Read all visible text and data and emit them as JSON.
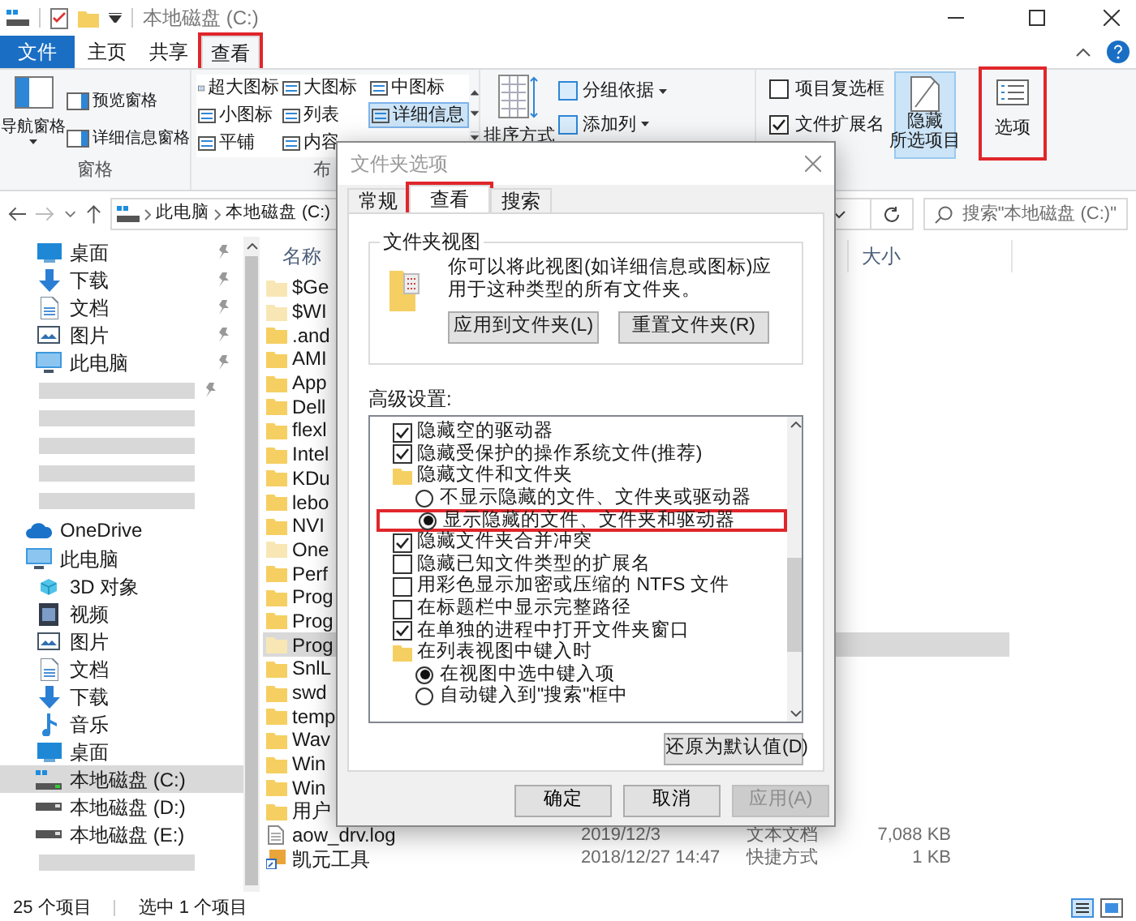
{
  "window": {
    "title": "本地磁盘 (C:)"
  },
  "ribbon": {
    "tabs": [
      {
        "label": "文件",
        "kind": "file",
        "selected": false,
        "annotated": false
      },
      {
        "label": "主页",
        "kind": "tab",
        "selected": false,
        "annotated": false
      },
      {
        "label": "共享",
        "kind": "tab",
        "selected": false,
        "annotated": false
      },
      {
        "label": "查看",
        "kind": "tab",
        "selected": true,
        "annotated": true
      }
    ],
    "pane_group": {
      "large_button": "导航窗格",
      "items": [
        "预览窗格",
        "详细信息窗格"
      ],
      "label": "窗格"
    },
    "layout_group": {
      "options": [
        {
          "label": "超大图标",
          "selected": false
        },
        {
          "label": "大图标",
          "selected": false
        },
        {
          "label": "中图标",
          "selected": false
        },
        {
          "label": "小图标",
          "selected": false
        },
        {
          "label": "列表",
          "selected": false
        },
        {
          "label": "详细信息",
          "selected": true
        },
        {
          "label": "平铺",
          "selected": false
        },
        {
          "label": "内容",
          "selected": false
        }
      ],
      "label": "布"
    },
    "view_group": {
      "sort_button": "排序方式",
      "items": [
        "分组依据",
        "添加列"
      ]
    },
    "show_group": {
      "checks": [
        {
          "label": "项目复选框",
          "checked": false
        },
        {
          "label": "文件扩展名",
          "checked": true
        }
      ],
      "hide_button": [
        "隐藏",
        "所选项目"
      ]
    },
    "options_button": {
      "label": "选项",
      "annotated": true
    }
  },
  "address": {
    "path": [
      "此电脑",
      "本地磁盘 (C:)"
    ],
    "search_placeholder": "搜索\"本地磁盘 (C:)\""
  },
  "nav": [
    {
      "label": "桌面",
      "kind": "desktop",
      "pinned": true,
      "selected": false
    },
    {
      "label": "下载",
      "kind": "download",
      "pinned": true,
      "selected": false
    },
    {
      "label": "文档",
      "kind": "document",
      "pinned": true,
      "selected": false
    },
    {
      "label": "图片",
      "kind": "picture",
      "pinned": true,
      "selected": false
    },
    {
      "label": "此电脑",
      "kind": "computer",
      "pinned": true,
      "selected": false
    },
    {
      "kind": "redacted",
      "pinned": true,
      "selected": false
    },
    {
      "kind": "redacted",
      "pinned": false,
      "selected": false
    },
    {
      "kind": "redacted",
      "pinned": false,
      "selected": false
    },
    {
      "kind": "redacted",
      "pinned": false,
      "selected": false
    },
    {
      "kind": "redacted",
      "pinned": false,
      "selected": false
    },
    {
      "label": "OneDrive",
      "kind": "cloud",
      "pinned": false,
      "selected": false,
      "top": true
    },
    {
      "label": "此电脑",
      "kind": "computer",
      "pinned": false,
      "selected": false,
      "top": true
    },
    {
      "label": "3D 对象",
      "kind": "cube",
      "pinned": false,
      "selected": false
    },
    {
      "label": "视频",
      "kind": "video",
      "pinned": false,
      "selected": false
    },
    {
      "label": "图片",
      "kind": "picture",
      "pinned": false,
      "selected": false
    },
    {
      "label": "文档",
      "kind": "document",
      "pinned": false,
      "selected": false
    },
    {
      "label": "下载",
      "kind": "download",
      "pinned": false,
      "selected": false
    },
    {
      "label": "音乐",
      "kind": "music",
      "pinned": false,
      "selected": false
    },
    {
      "label": "桌面",
      "kind": "desktop",
      "pinned": false,
      "selected": false
    },
    {
      "label": "本地磁盘 (C:)",
      "kind": "system-drive",
      "pinned": false,
      "selected": true
    },
    {
      "label": "本地磁盘 (D:)",
      "kind": "drive",
      "pinned": false,
      "selected": false
    },
    {
      "label": "本地磁盘 (E:)",
      "kind": "drive",
      "pinned": false,
      "selected": false
    },
    {
      "kind": "redacted",
      "pinned": false,
      "selected": false
    }
  ],
  "files": {
    "columns": [
      "名称",
      "大小"
    ],
    "rows": [
      {
        "name": "$Ge",
        "kind": "folder",
        "hidden": true,
        "selected": false
      },
      {
        "name": "$WI",
        "kind": "folder",
        "hidden": true,
        "selected": false
      },
      {
        "name": ".and",
        "kind": "folder",
        "hidden": false,
        "selected": false
      },
      {
        "name": "AMI",
        "kind": "folder",
        "hidden": false,
        "selected": false
      },
      {
        "name": "App",
        "kind": "folder",
        "hidden": false,
        "selected": false
      },
      {
        "name": "Dell",
        "kind": "folder",
        "hidden": false,
        "selected": false
      },
      {
        "name": "flexl",
        "kind": "folder",
        "hidden": false,
        "selected": false
      },
      {
        "name": "Intel",
        "kind": "folder",
        "hidden": false,
        "selected": false
      },
      {
        "name": "KDu",
        "kind": "folder",
        "hidden": false,
        "selected": false
      },
      {
        "name": "lebo",
        "kind": "folder",
        "hidden": false,
        "selected": false
      },
      {
        "name": "NVI",
        "kind": "folder",
        "hidden": false,
        "selected": false
      },
      {
        "name": "One",
        "kind": "folder",
        "hidden": true,
        "selected": false
      },
      {
        "name": "Perf",
        "kind": "folder",
        "hidden": false,
        "selected": false
      },
      {
        "name": "Prog",
        "kind": "folder",
        "hidden": false,
        "selected": false
      },
      {
        "name": "Prog",
        "kind": "folder",
        "hidden": false,
        "selected": false
      },
      {
        "name": "Prog",
        "kind": "folder",
        "hidden": true,
        "selected": true
      },
      {
        "name": "SnlL",
        "kind": "folder",
        "hidden": false,
        "selected": false
      },
      {
        "name": "swd",
        "kind": "folder",
        "hidden": false,
        "selected": false
      },
      {
        "name": "temp",
        "kind": "folder",
        "hidden": false,
        "selected": false
      },
      {
        "name": "Wav",
        "kind": "folder",
        "hidden": false,
        "selected": false
      },
      {
        "name": "Win",
        "kind": "folder",
        "hidden": false,
        "selected": false
      },
      {
        "name": "Win",
        "kind": "folder",
        "hidden": false,
        "selected": false
      },
      {
        "name": "用户",
        "kind": "folder",
        "hidden": false,
        "selected": false
      },
      {
        "name": "aow_drv.log",
        "kind": "text",
        "hidden": false,
        "selected": false,
        "date": "2019/12/3",
        "type": "文本文档",
        "size": "7,088 KB"
      },
      {
        "name": "凯元工具",
        "kind": "shortcut",
        "hidden": false,
        "selected": false,
        "date": "2018/12/27 14:47",
        "type": "快捷方式",
        "size": "1 KB"
      }
    ]
  },
  "status_bar": {
    "count": "25 个项目",
    "selection": "选中 1 个项目"
  },
  "dialog": {
    "title": "文件夹选项",
    "tabs": [
      {
        "label": "常规",
        "selected": false,
        "annotated": false
      },
      {
        "label": "查看",
        "selected": true,
        "annotated": true
      },
      {
        "label": "搜索",
        "selected": false,
        "annotated": false
      }
    ],
    "folder_view": {
      "title": "文件夹视图",
      "text": "你可以将此视图(如详细信息或图标)应用于这种类型的所有文件夹。",
      "buttons": [
        "应用到文件夹(L)",
        "重置文件夹(R)"
      ]
    },
    "advanced_label": "高级设置:",
    "settings": [
      {
        "kind": "checkbox",
        "label": "隐藏空的驱动器",
        "checked": true
      },
      {
        "kind": "checkbox",
        "label": "隐藏受保护的操作系统文件(推荐)",
        "checked": true
      },
      {
        "kind": "folder",
        "label": "隐藏文件和文件夹",
        "children": [
          {
            "kind": "radio",
            "label": "不显示隐藏的文件、文件夹或驱动器",
            "selected": false,
            "annotated": false
          },
          {
            "kind": "radio",
            "label": "显示隐藏的文件、文件夹和驱动器",
            "selected": true,
            "annotated": true
          }
        ]
      },
      {
        "kind": "checkbox",
        "label": "隐藏文件夹合并冲突",
        "checked": true
      },
      {
        "kind": "checkbox",
        "label": "隐藏已知文件类型的扩展名",
        "checked": false
      },
      {
        "kind": "checkbox",
        "label": "用彩色显示加密或压缩的 NTFS 文件",
        "checked": false
      },
      {
        "kind": "checkbox",
        "label": "在标题栏中显示完整路径",
        "checked": false
      },
      {
        "kind": "checkbox",
        "label": "在单独的进程中打开文件夹窗口",
        "checked": true
      },
      {
        "kind": "folder",
        "label": "在列表视图中键入时",
        "children": [
          {
            "kind": "radio",
            "label": "在视图中选中键入项",
            "selected": true,
            "annotated": false
          },
          {
            "kind": "radio",
            "label": "自动键入到\"搜索\"框中",
            "selected": false,
            "annotated": false
          }
        ]
      }
    ],
    "restore_button": "还原为默认值(D)",
    "buttons": [
      {
        "label": "确定",
        "disabled": false
      },
      {
        "label": "取消",
        "disabled": false
      },
      {
        "label": "应用(A)",
        "disabled": true
      }
    ]
  }
}
